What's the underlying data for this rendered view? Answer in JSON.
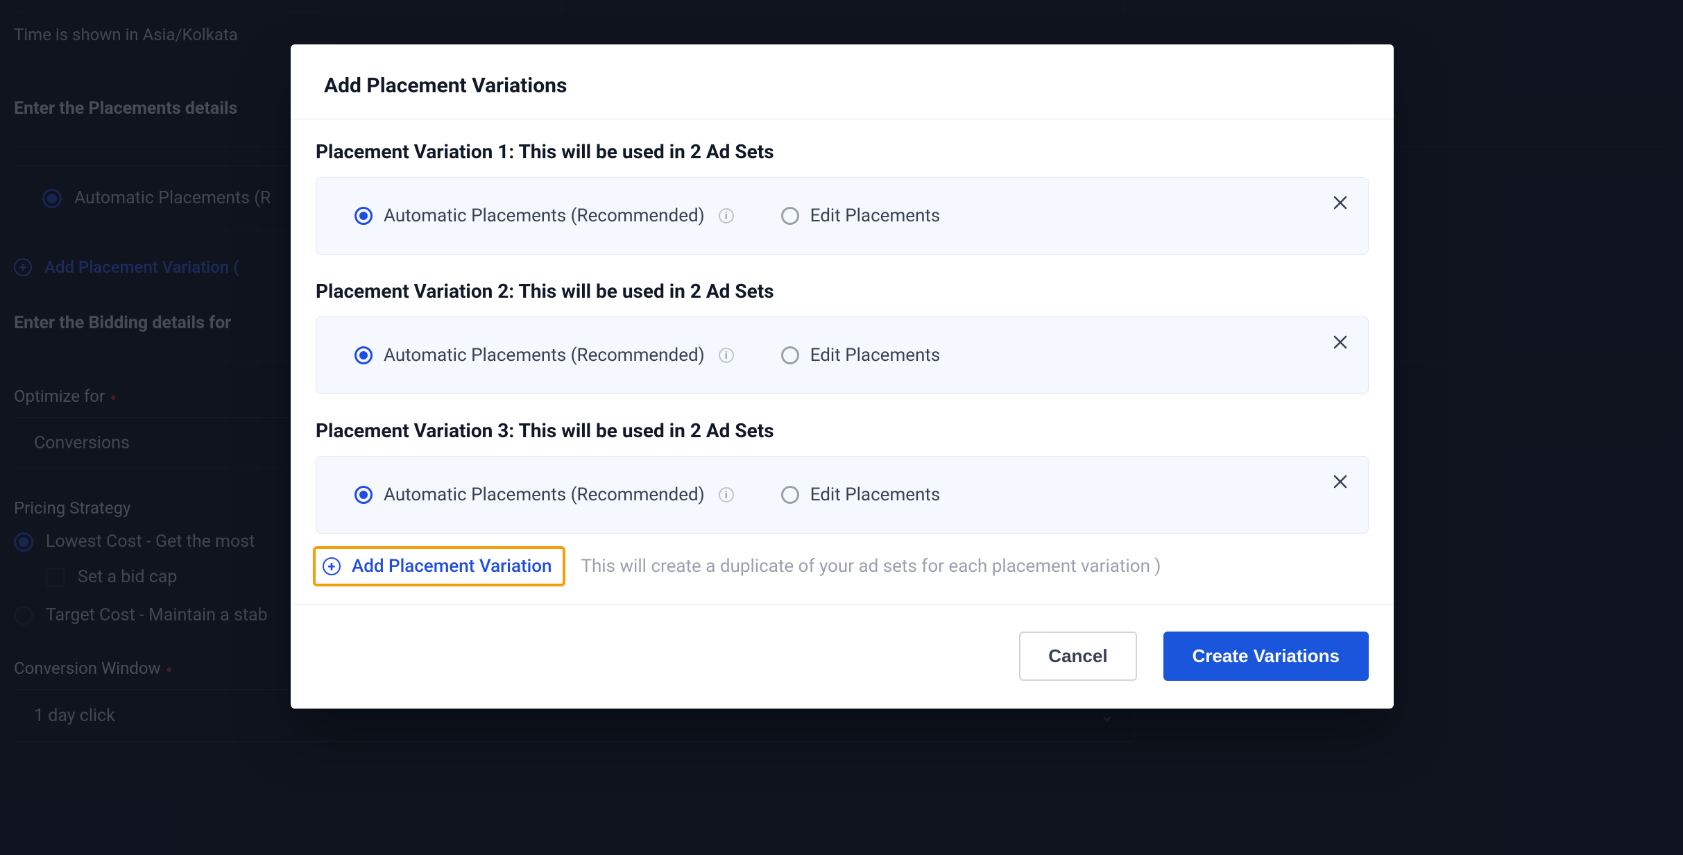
{
  "bg": {
    "timezone_note": "Time is shown in Asia/Kolkata",
    "placements_header": "Enter the Placements details",
    "auto_placements_label": "Automatic Placements (R",
    "add_placement_link": "Add Placement Variation (",
    "bidding_header": "Enter the Bidding details for",
    "optimize_label": "Optimize for",
    "optimize_value": "Conversions",
    "pricing_label": "Pricing Strategy",
    "lowest_cost_label": "Lowest Cost - Get the most",
    "bid_cap_label": "Set a bid cap",
    "target_cost_label": "Target Cost - Maintain a stab",
    "conv_window_label": "Conversion Window",
    "conv_window_value": "1 day click"
  },
  "modal": {
    "title": "Add Placement Variations",
    "variations": [
      {
        "title": "Placement Variation 1: This will be used in 2 Ad Sets"
      },
      {
        "title": "Placement Variation 2: This will be used in 2 Ad Sets"
      },
      {
        "title": "Placement Variation 3: This will be used in 2 Ad Sets"
      }
    ],
    "option_auto": "Automatic Placements (Recommended)",
    "option_edit": "Edit Placements",
    "add_label": "Add Placement Variation",
    "add_helper": "This will create a duplicate of your ad sets for each placement variation )",
    "cancel": "Cancel",
    "create": "Create Variations"
  }
}
